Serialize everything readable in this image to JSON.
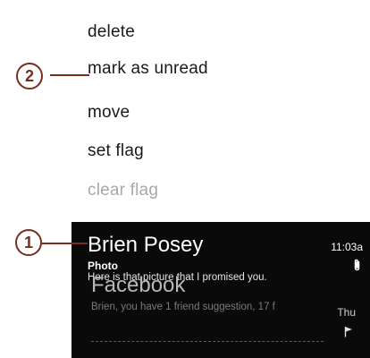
{
  "context_menu": {
    "items": [
      {
        "label": "delete",
        "disabled": false
      },
      {
        "label": "mark as unread",
        "disabled": false
      },
      {
        "label": "move",
        "disabled": false
      },
      {
        "label": "set flag",
        "disabled": false
      },
      {
        "label": "clear flag",
        "disabled": true
      }
    ]
  },
  "messages": [
    {
      "sender": "Brien Posey",
      "subject": "Photo",
      "preview": "Here is that picture that I promised you.",
      "time": "11:03a",
      "icon": "paperclip-icon"
    },
    {
      "sender": "Facebook",
      "preview": "Brien, you have 1 friend suggestion, 17 f",
      "time": "Thu",
      "icon": "flag-icon"
    }
  ],
  "callouts": [
    {
      "number": "1"
    },
    {
      "number": "2"
    }
  ],
  "colors": {
    "callout": "#7a2e1e",
    "list_background": "#0a0a0a",
    "disabled_text": "#a8a8a8"
  }
}
